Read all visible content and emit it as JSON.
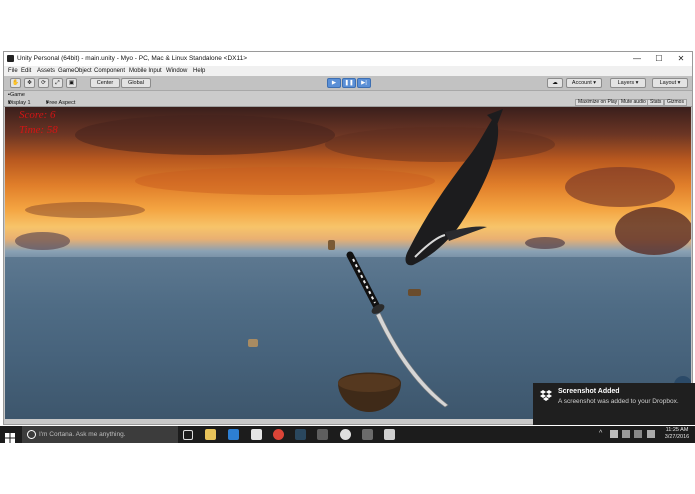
{
  "window": {
    "title": "Unity Personal (64bit) - main.unity - Myo - PC, Mac & Linux Standalone <DX11>",
    "controls": {
      "minimize": "—",
      "maximize": "☐",
      "close": "✕"
    }
  },
  "menubar": [
    "File",
    "Edit",
    "Assets",
    "GameObject",
    "Component",
    "Mobile Input",
    "Window",
    "Help"
  ],
  "toolbar": {
    "pivot": "Center",
    "space": "Global",
    "play": "▶",
    "pause": "❚❚",
    "step": "▶|",
    "account": "Account",
    "layers": "Layers",
    "layout": "Layout",
    "cloud_icon": "cloud-icon"
  },
  "game_tab": {
    "label": "Game",
    "display": "Display 1",
    "aspect": "Free Aspect",
    "buttons": [
      "Maximize on Play",
      "Mute audio",
      "Stats",
      "Gizmos"
    ]
  },
  "hud": {
    "line1": "Score: 6",
    "line2": "Time: 58"
  },
  "taskbar": {
    "search_placeholder": "I'm Cortana. Ask me anything.",
    "time": "11:25 AM",
    "date": "3/27/2016"
  },
  "toast": {
    "title": "Screenshot Added",
    "message": "A screenshot was added to your Dropbox."
  },
  "colors": {
    "hud_text": "#d41414",
    "play_active": "#5a8fd6",
    "taskbar": "#1c1c1c"
  }
}
